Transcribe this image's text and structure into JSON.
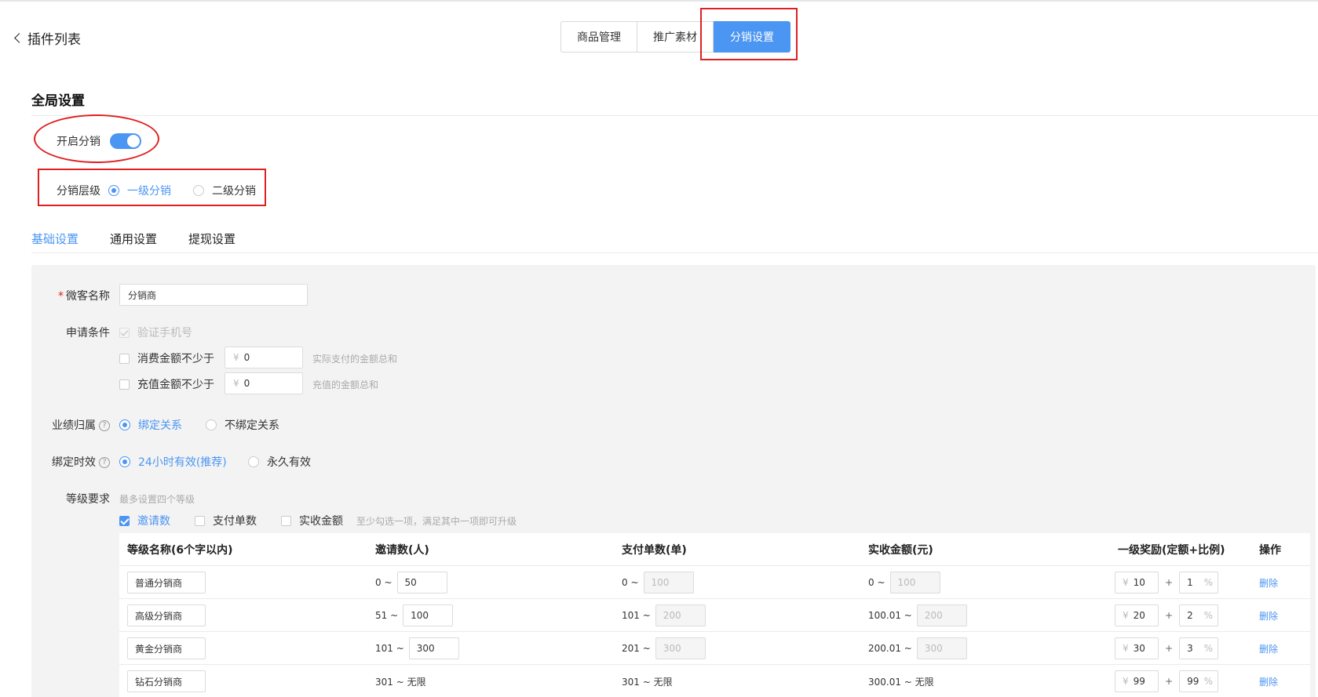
{
  "header": {
    "back_label": "插件列表",
    "tabs": [
      "商品管理",
      "推广素材",
      "分销设置"
    ]
  },
  "global": {
    "title": "全局设置",
    "enable_label": "开启分销",
    "level_label": "分销层级",
    "level_options": [
      "一级分销",
      "二级分销"
    ],
    "accent_color": "#4b95f3",
    "highlight_color": "#e02020"
  },
  "subtabs": [
    "基础设置",
    "通用设置",
    "提现设置"
  ],
  "form": {
    "name_label": "微客名称",
    "name_value": "分销商",
    "apply_label": "申请条件",
    "apply_options": {
      "phone": "验证手机号",
      "spend": "消费金额不少于",
      "spend_value": "0",
      "spend_hint": "实际支付的金额总和",
      "recharge": "充值金额不少于",
      "recharge_value": "0",
      "recharge_hint": "充值的金额总和",
      "currency": "¥"
    },
    "perf_label": "业绩归属",
    "perf_options": [
      "绑定关系",
      "不绑定关系"
    ],
    "bind_label": "绑定时效",
    "bind_options": [
      "24小时有效(推荐)",
      "永久有效"
    ],
    "grade_label": "等级要求",
    "grade_hint": "最多设置四个等级",
    "grade_checks": [
      "邀请数",
      "支付单数",
      "实收金额"
    ],
    "grade_checks_hint": "至少勾选一项，满足其中一项即可升级",
    "help_icon": "question-circle-icon"
  },
  "table": {
    "headers": [
      "等级名称(6个字以内)",
      "邀请数(人)",
      "支付单数(单)",
      "实收金额(元)",
      "一级奖励(定额+比例)",
      "操作"
    ],
    "rows": [
      {
        "name": "普通分销商",
        "inv_from": "0 ~",
        "inv_to": "50",
        "pay_from": "0 ~",
        "pay_to": "100",
        "amt_from": "0 ~",
        "amt_to": "100",
        "fixed": "10",
        "ratio": "1",
        "action": "删除"
      },
      {
        "name": "高级分销商",
        "inv_from": "51 ~",
        "inv_to": "100",
        "pay_from": "101 ~",
        "pay_to": "200",
        "amt_from": "100.01 ~",
        "amt_to": "200",
        "fixed": "20",
        "ratio": "2",
        "action": "删除"
      },
      {
        "name": "黄金分销商",
        "inv_from": "101 ~",
        "inv_to": "300",
        "pay_from": "201 ~",
        "pay_to": "300",
        "amt_from": "200.01 ~",
        "amt_to": "300",
        "fixed": "30",
        "ratio": "3",
        "action": "删除"
      },
      {
        "name": "钻石分销商",
        "inv_from": "301 ~ 无限",
        "inv_to": "",
        "pay_from": "301 ~ 无限",
        "pay_to": "",
        "amt_from": "300.01 ~ 无限",
        "amt_to": "",
        "fixed": "99",
        "ratio": "99",
        "action": "删除"
      }
    ],
    "currency": "¥",
    "percent": "%",
    "plus": "+"
  }
}
